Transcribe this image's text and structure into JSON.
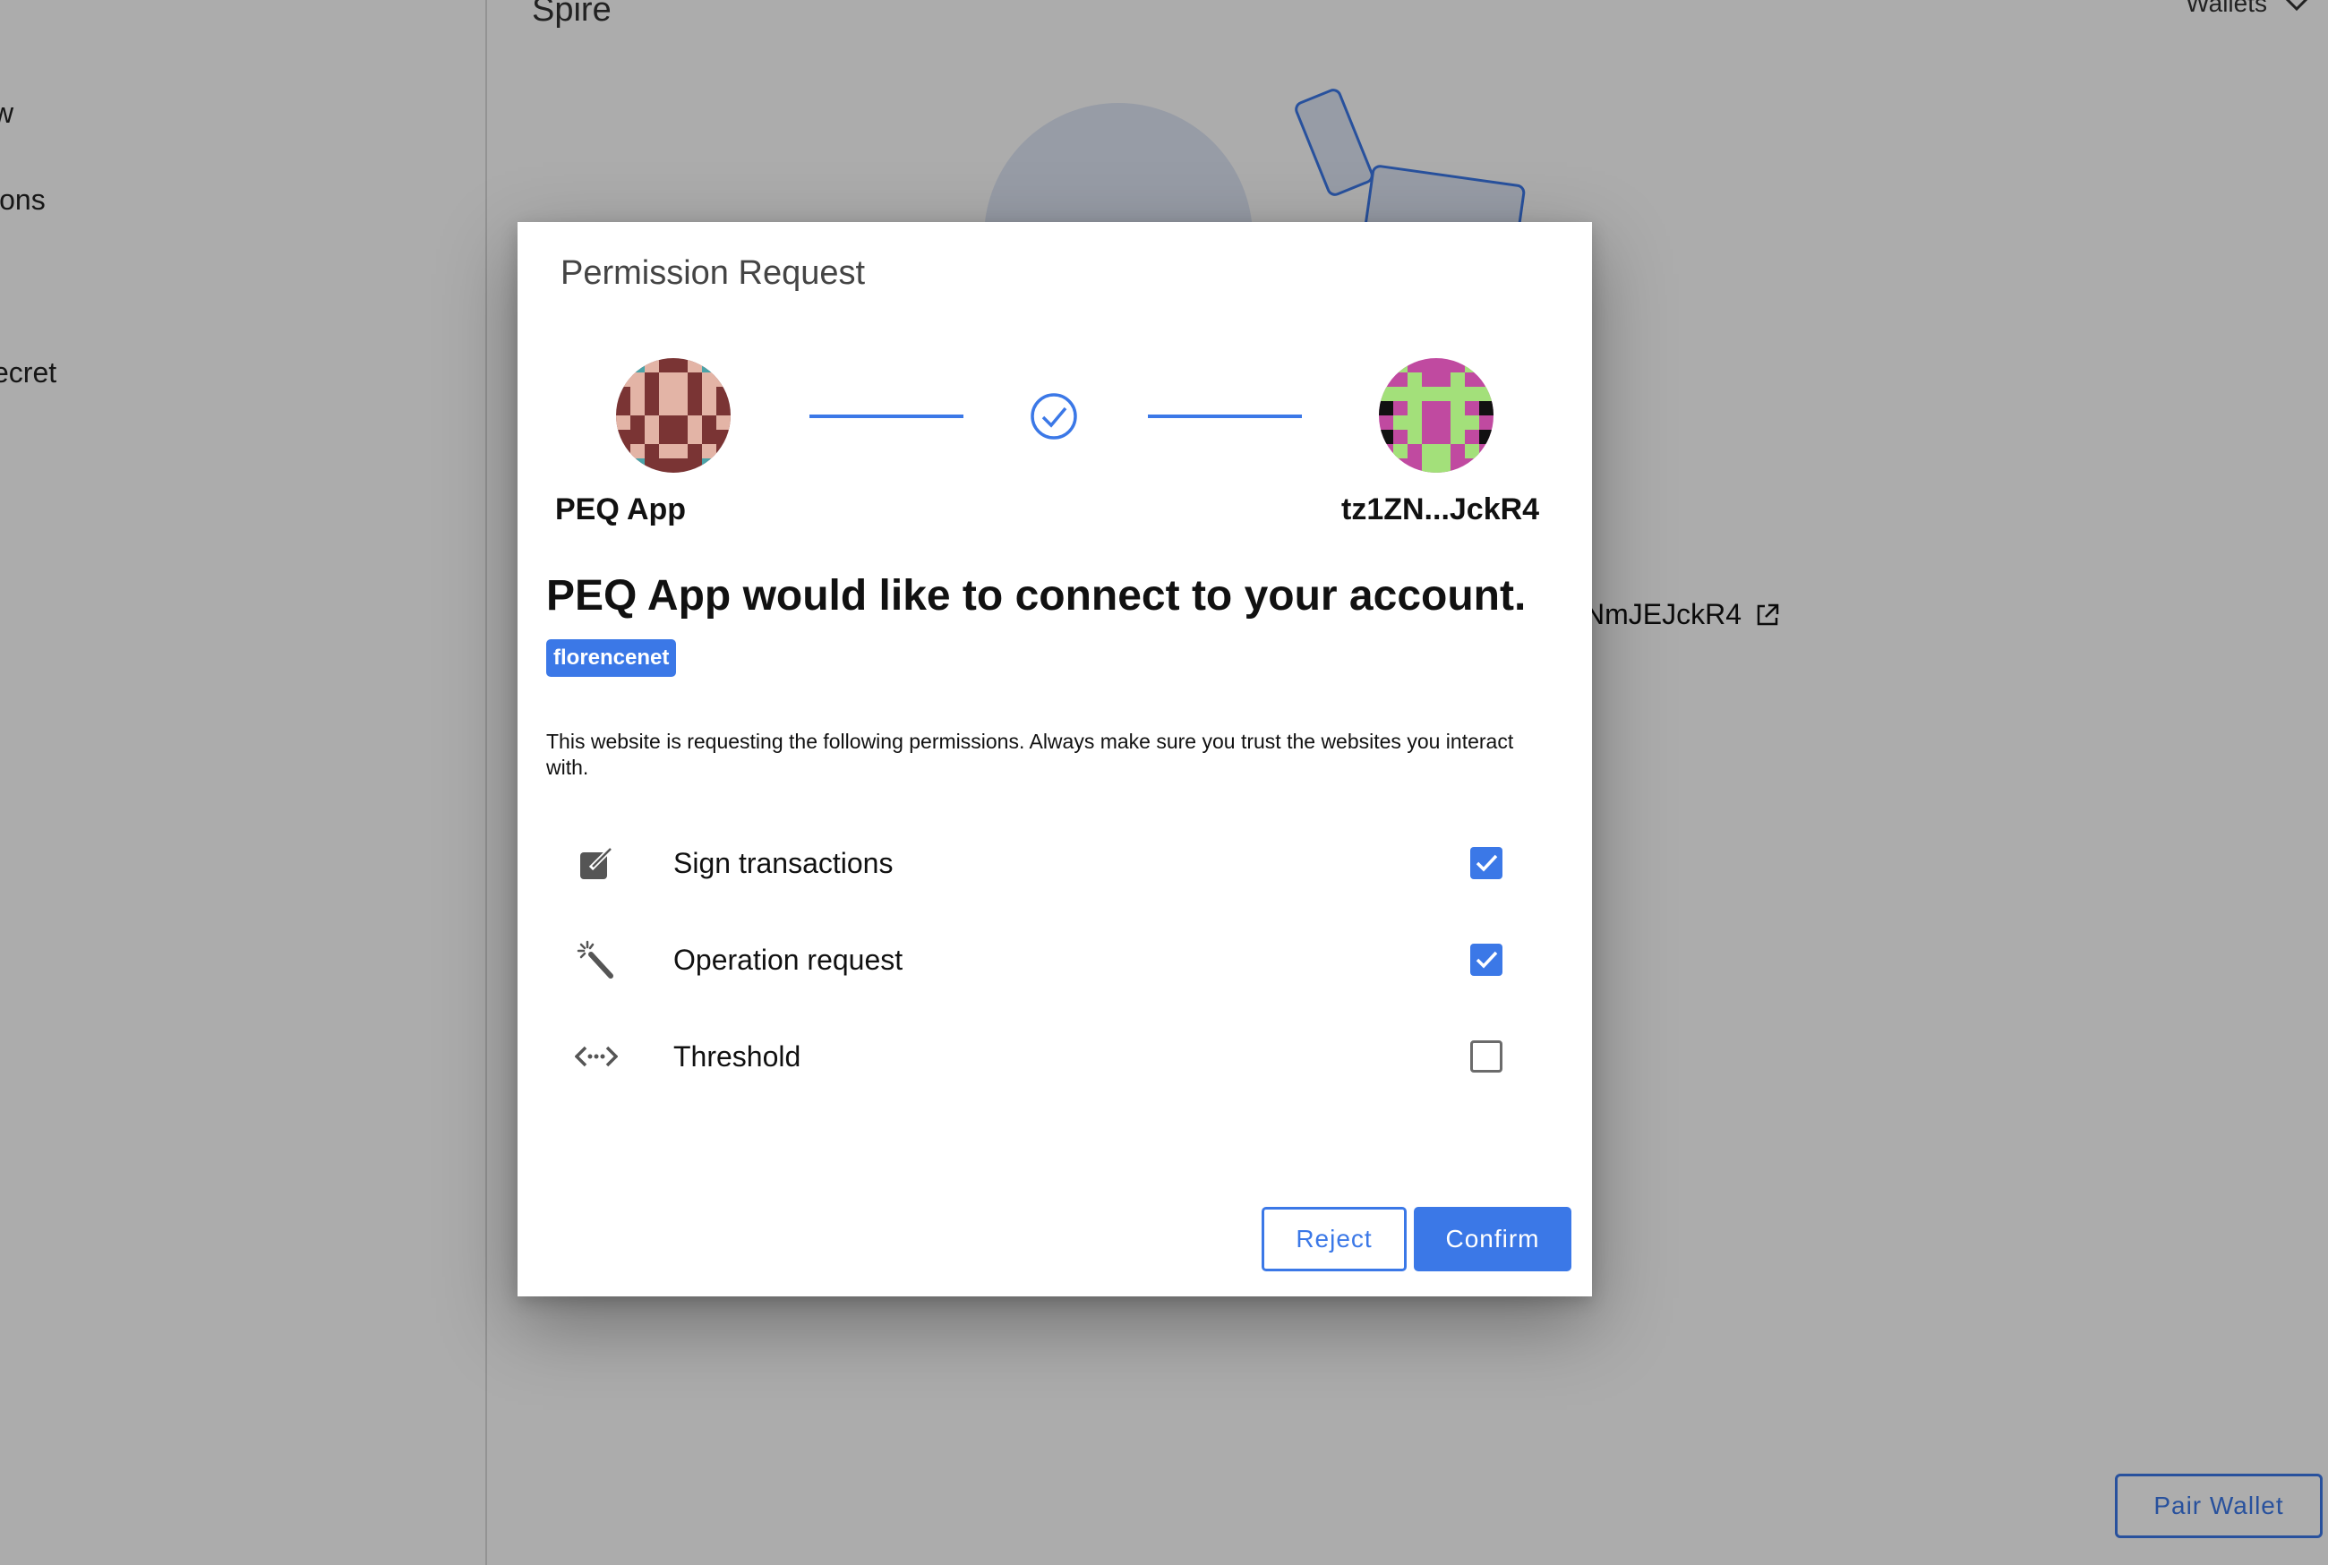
{
  "app": {
    "title": "Spire",
    "wallets_label": "Wallets",
    "sidebar_items": [
      "w",
      "ions",
      "ecret"
    ],
    "address_partial": "NmJEJckR4",
    "pair_wallet_label": "Pair Wallet"
  },
  "modal": {
    "title": "Permission Request",
    "app_name": "PEQ App",
    "account_name": "tz1ZN...JckR4",
    "headline": "PEQ App would like to connect to your account.",
    "network_badge": "florencenet",
    "description": "This website is requesting the following permissions. Always make sure you trust the websites you interact with.",
    "permissions": [
      {
        "label": "Sign transactions",
        "icon": "edit-icon",
        "checked": true
      },
      {
        "label": "Operation request",
        "icon": "magic-wand-icon",
        "checked": true
      },
      {
        "label": "Threshold",
        "icon": "code-arrows-icon",
        "checked": false
      }
    ],
    "reject_label": "Reject",
    "confirm_label": "Confirm"
  },
  "colors": {
    "accent": "#3b78e7",
    "overlay": "rgba(0,0,0,0.32)"
  }
}
